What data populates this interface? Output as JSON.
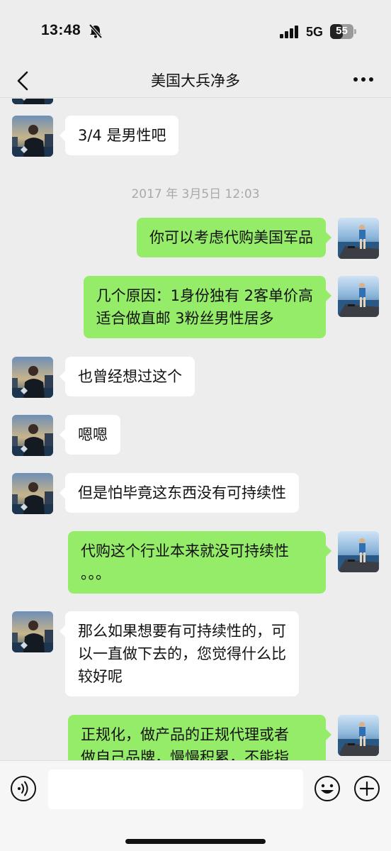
{
  "status_bar": {
    "time": "13:48",
    "network": "5G",
    "battery_percent": "55",
    "battery_level": 0.55,
    "icons": [
      "bell-muted-icon",
      "signal-icon",
      "battery-icon"
    ]
  },
  "header": {
    "title": "美国大兵净多",
    "icons": [
      "chevron-left-icon",
      "more-dots-icon"
    ]
  },
  "messages": [
    {
      "side": "left",
      "text": "3/4 是男性吧"
    },
    {
      "type": "timestamp",
      "text": "2017 年 3月5日 12:03"
    },
    {
      "side": "right",
      "text": "你可以考虑代购美国军品"
    },
    {
      "side": "right",
      "lines": [
        "几个原因：1身份独有 2客单价高",
        "适合做直邮 3粉丝男性居多"
      ]
    },
    {
      "side": "left",
      "text": "也曾经想过这个"
    },
    {
      "side": "left",
      "text": "嗯嗯"
    },
    {
      "side": "left",
      "text": "但是怕毕竟这东西没有可持续性"
    },
    {
      "side": "right",
      "lines": [
        "代购这个行业本来就没可持续性",
        "。。。"
      ]
    },
    {
      "side": "left",
      "lines": [
        "那么如果想要有可持续性的，可",
        "以一直做下去的，您觉得什么比",
        "较好呢"
      ]
    },
    {
      "side": "right",
      "lines": [
        "正规化，做产品的正规代理或者",
        "做自己品牌，慢慢积累，不能指"
      ]
    }
  ],
  "input_bar": {
    "input_value": "",
    "icons": [
      "voice-icon",
      "emoji-icon",
      "plus-icon"
    ]
  },
  "colors": {
    "background": "#ededed",
    "sent_bubble": "#95ec69",
    "received_bubble": "#ffffff",
    "timestamp_text": "#a9a9a9"
  }
}
